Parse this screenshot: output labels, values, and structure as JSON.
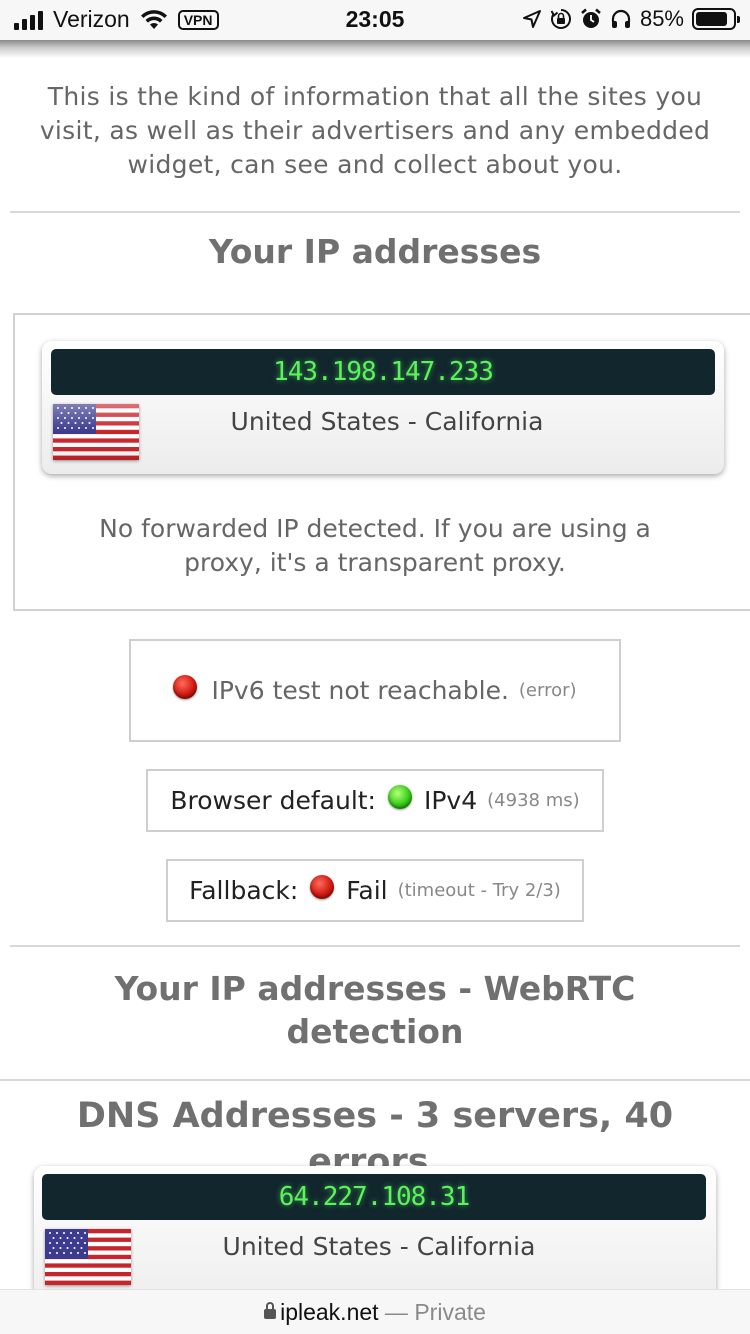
{
  "status_bar": {
    "carrier": "Verizon",
    "vpn_badge": "VPN",
    "time": "23:05",
    "battery_percent": "85%",
    "battery_level": 0.85,
    "icons": [
      "signal-icon",
      "wifi-icon",
      "location-arrow-icon",
      "orientation-lock-icon",
      "alarm-icon",
      "headphones-icon",
      "battery-icon"
    ]
  },
  "intro_text": "This is the kind of information that all the sites you visit, as well as their advertisers and any embedded widget, can see and collect about you.",
  "ip_section": {
    "title": "Your IP addresses",
    "ip": "143.198.147.233",
    "location": "United States - California",
    "flag": "us-flag",
    "note": "No forwarded IP detected. If you are using a proxy, it's a transparent proxy."
  },
  "ipv6_test": {
    "status": "red",
    "text": "IPv6 test not reachable.",
    "detail": "(error)"
  },
  "browser_default": {
    "label": "Browser default:",
    "status": "green",
    "value": "IPv4",
    "detail": "(4938 ms)"
  },
  "fallback": {
    "label": "Fallback:",
    "status": "red",
    "value": "Fail",
    "detail": "(timeout - Try 2/3)"
  },
  "webrtc_section": {
    "title_line1": "Your IP addresses - WebRTC",
    "title_line2": "detection"
  },
  "dns_section": {
    "title_line1": "DNS Addresses - 3 servers, 40",
    "title_line2": "errors.",
    "ip": "64.227.108.31",
    "location": "United States - California",
    "flag": "us-flag"
  },
  "bottom_bar": {
    "domain": "ipleak.net",
    "separator": " — ",
    "mode": "Private"
  },
  "colors": {
    "ip_bar_bg": "#11262d",
    "ip_text": "#5cf25c",
    "heading": "#707070",
    "status_red": "#d01810",
    "status_green": "#33cc14"
  }
}
